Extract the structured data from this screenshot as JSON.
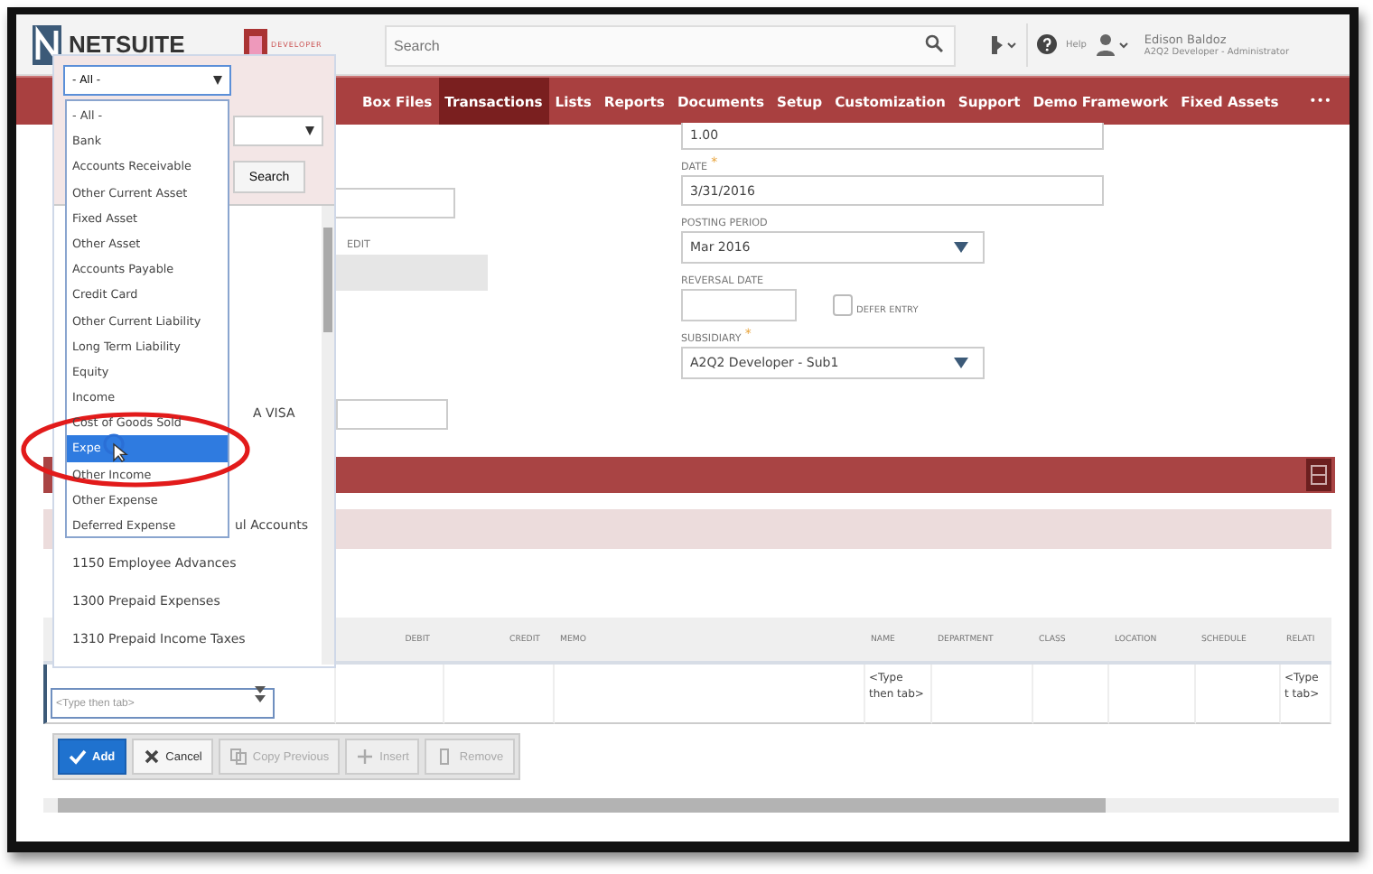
{
  "header": {
    "logo": "NETSUITE",
    "badge": "DEVELOPER",
    "search": {
      "placeholder": "Search"
    },
    "help": "Help",
    "user": {
      "name": "Edison Baldoz",
      "role": "A2Q2 Developer - Administrator"
    }
  },
  "nav": {
    "items": [
      {
        "label": "Box Files",
        "selected": false
      },
      {
        "label": "Transactions",
        "selected": true
      },
      {
        "label": "Lists",
        "selected": false
      },
      {
        "label": "Reports",
        "selected": false
      },
      {
        "label": "Documents",
        "selected": false
      },
      {
        "label": "Setup",
        "selected": false
      },
      {
        "label": "Customization",
        "selected": false
      },
      {
        "label": "Support",
        "selected": false
      },
      {
        "label": "Demo Framework",
        "selected": false
      },
      {
        "label": "Fixed Assets",
        "selected": false
      }
    ],
    "more": "•••"
  },
  "form": {
    "middle": {
      "label": "EDIT"
    },
    "required_mark": "*",
    "right": [
      {
        "kind": "field",
        "value": "1.00"
      },
      {
        "kind": "field",
        "label": "DATE",
        "required": true,
        "value": "3/31/2016"
      },
      {
        "kind": "select",
        "label": "POSTING PERIOD",
        "required": false,
        "value": "Mar 2016"
      },
      {
        "kind": "date_checkbox",
        "label": "REVERSAL DATE",
        "required": false,
        "checkbox": {
          "label": "DEFER ENTRY",
          "checked": false
        }
      },
      {
        "kind": "select",
        "label": "SUBSIDIARY",
        "required": true,
        "value": "A2Q2 Developer - Sub1"
      }
    ]
  },
  "lines": {
    "columns": [
      "",
      "DEBIT",
      "CREDIT",
      "MEMO",
      "NAME",
      "DEPARTMENT",
      "CLASS",
      "LOCATION",
      "SCHEDULE",
      "RELATI"
    ],
    "row": [
      {
        "kind": "field",
        "placeholder": "<Type then tab>"
      },
      {
        "kind": "empty"
      },
      {
        "kind": "empty"
      },
      {
        "kind": "empty"
      },
      {
        "kind": "text",
        "text": "<Type then tab>"
      },
      {
        "kind": "empty"
      },
      {
        "kind": "empty"
      },
      {
        "kind": "empty"
      },
      {
        "kind": "empty"
      },
      {
        "kind": "text",
        "text": "<Type t tab>"
      }
    ],
    "buttons": [
      {
        "kind": "add",
        "label": "Add",
        "disabled": false
      },
      {
        "kind": "cancel",
        "label": "Cancel",
        "disabled": false
      },
      {
        "kind": "copy",
        "label": "Copy Previous",
        "disabled": true
      },
      {
        "kind": "insert",
        "label": "Insert",
        "disabled": true
      },
      {
        "kind": "remove",
        "label": "Remove",
        "disabled": true
      }
    ]
  },
  "popup": {
    "type_select": {
      "value": "- All -"
    },
    "search_button": "Search",
    "accounts": [
      "A VISA",
      "ul Accounts",
      "1150 Employee Advances",
      "1300 Prepaid Expenses",
      "1310 Prepaid Income Taxes"
    ],
    "options": [
      {
        "label": "- All -",
        "selected": false
      },
      {
        "label": "Bank",
        "selected": false
      },
      {
        "label": "Accounts Receivable",
        "selected": false
      },
      {
        "label": "Other Current Asset",
        "selected": false
      },
      {
        "label": "Fixed Asset",
        "selected": false
      },
      {
        "label": "Other Asset",
        "selected": false
      },
      {
        "label": "Accounts Payable",
        "selected": false
      },
      {
        "label": "Credit Card",
        "selected": false
      },
      {
        "label": "Other Current Liability",
        "selected": false
      },
      {
        "label": "Long Term Liability",
        "selected": false
      },
      {
        "label": "Equity",
        "selected": false
      },
      {
        "label": "Income",
        "selected": false
      },
      {
        "label": "Cost of Goods Sold",
        "selected": false
      },
      {
        "label": "Expe",
        "selected": true
      },
      {
        "label": "Other Income",
        "selected": false
      },
      {
        "label": "Other Expense",
        "selected": false
      },
      {
        "label": "Deferred Expense",
        "selected": false
      }
    ]
  }
}
